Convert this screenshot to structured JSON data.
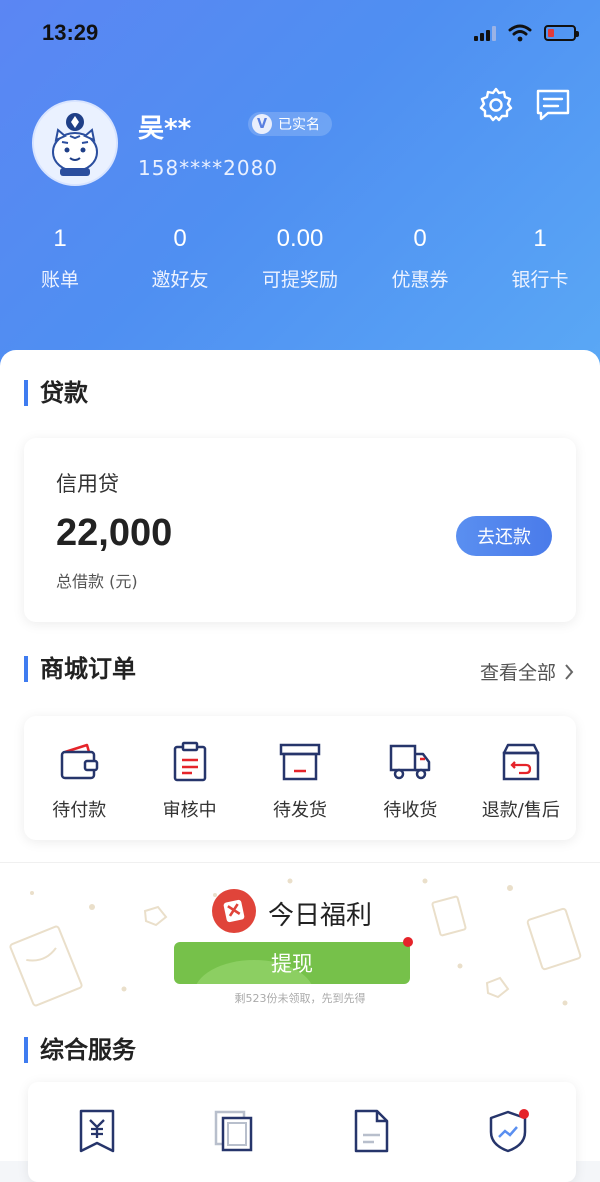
{
  "status_bar": {
    "time": "13:29"
  },
  "profile": {
    "name": "吴**",
    "verified_label": "已实名",
    "verified_badge": "V",
    "phone": "158****2080"
  },
  "stats": [
    {
      "value": "1",
      "label": "账单"
    },
    {
      "value": "0",
      "label": "邀好友"
    },
    {
      "value": "0.00",
      "label": "可提奖励"
    },
    {
      "value": "0",
      "label": "优惠券"
    },
    {
      "value": "1",
      "label": "银行卡"
    }
  ],
  "loan": {
    "section_title": "贷款",
    "product_name": "信用贷",
    "amount": "22,000",
    "amount_label": "总借款 (元)",
    "repay_button": "去还款"
  },
  "orders": {
    "section_title": "商城订单",
    "view_all": "查看全部",
    "items": [
      {
        "label": "待付款",
        "icon": "wallet-icon"
      },
      {
        "label": "审核中",
        "icon": "clipboard-icon"
      },
      {
        "label": "待发货",
        "icon": "box-icon"
      },
      {
        "label": "待收货",
        "icon": "truck-icon"
      },
      {
        "label": "退款/售后",
        "icon": "return-box-icon"
      }
    ]
  },
  "welfare": {
    "title": "今日福利",
    "button": "提现",
    "note": "剩523份未领取，先到先得"
  },
  "services": {
    "section_title": "综合服务",
    "items": [
      {
        "icon": "receipt-yuan-icon"
      },
      {
        "icon": "copy-layers-icon"
      },
      {
        "icon": "document-icon"
      },
      {
        "icon": "shield-chart-icon"
      }
    ]
  },
  "colors": {
    "header_gradient": [
      "#5b86f3",
      "#5aa8f5"
    ],
    "accent": "#3f7cf0",
    "icon_red": "#e5242a",
    "welfare_green": "#76c14a"
  }
}
